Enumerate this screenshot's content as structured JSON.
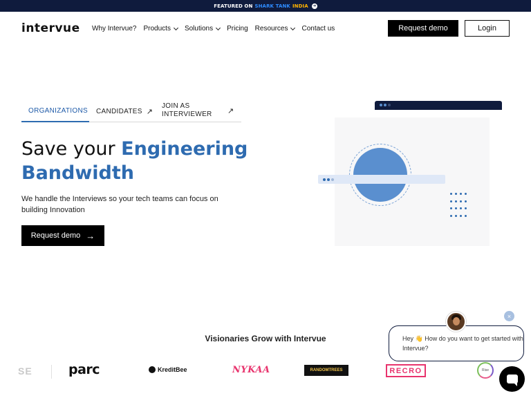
{
  "banner": {
    "featured_on": "FEATURED ON",
    "shark_tank": "SHARK TANK",
    "india": "INDIA",
    "arrow": "➜"
  },
  "nav": {
    "logo": "intervue",
    "items": [
      {
        "label": "Why Intervue?",
        "dropdown": false
      },
      {
        "label": "Products",
        "dropdown": true
      },
      {
        "label": "Solutions",
        "dropdown": true
      },
      {
        "label": "Pricing",
        "dropdown": false
      },
      {
        "label": "Resources",
        "dropdown": true
      },
      {
        "label": "Contact us",
        "dropdown": false
      }
    ],
    "request_demo": "Request demo",
    "login": "Login"
  },
  "hero": {
    "tabs": [
      {
        "label": "ORGANIZATIONS",
        "active": true
      },
      {
        "label": "CANDIDATES",
        "external": true
      },
      {
        "label": "JOIN AS INTERVIEWER",
        "external": true
      }
    ],
    "external_arrow": "↗",
    "headline_plain": "Save your ",
    "headline_accent_1": "Engineering",
    "headline_accent_2": "Bandwidth",
    "subtext": "We handle the Interviews so your tech teams can focus on building Innovation",
    "cta_label": "Request demo",
    "cta_arrow": "→"
  },
  "logos": {
    "heading": "Visionaries Grow with Intervue",
    "items": [
      "SE",
      "parc",
      "KreditBee",
      "NYKAA",
      "RANDOMTREES",
      "RECRO",
      "Rise"
    ]
  },
  "chat": {
    "message": "Hey 👋 How do you want to get started with Intervue?",
    "close": "×"
  },
  "colors": {
    "navy": "#0f1b3d",
    "accent_blue": "#2e6bb0",
    "black": "#000000",
    "pink": "#e8336d"
  }
}
